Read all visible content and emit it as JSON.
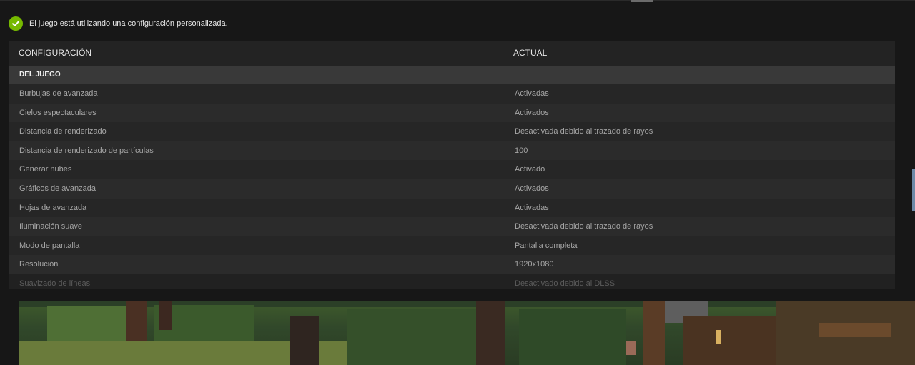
{
  "status": {
    "icon": "check-circle-icon",
    "message": "El juego está utilizando una configuración personalizada."
  },
  "table": {
    "headers": {
      "setting": "CONFIGURACIÓN",
      "current": "ACTUAL"
    },
    "section": "DEL JUEGO",
    "rows": [
      {
        "setting": "Burbujas de avanzada",
        "value": "Activadas"
      },
      {
        "setting": "Cielos espectaculares",
        "value": "Activados"
      },
      {
        "setting": "Distancia de renderizado",
        "value": "Desactivada debido al trazado de rayos"
      },
      {
        "setting": "Distancia de renderizado de partículas",
        "value": "100"
      },
      {
        "setting": "Generar nubes",
        "value": "Activado"
      },
      {
        "setting": "Gráficos de avanzada",
        "value": "Activados"
      },
      {
        "setting": "Hojas de avanzada",
        "value": "Activadas"
      },
      {
        "setting": "Iluminación suave",
        "value": "Desactivada debido al trazado de rayos"
      },
      {
        "setting": "Modo de pantalla",
        "value": "Pantalla completa"
      },
      {
        "setting": "Resolución",
        "value": "1920x1080"
      },
      {
        "setting": "Suavizado de líneas",
        "value": "Desactivado debido al DLSS"
      }
    ]
  },
  "colors": {
    "accent": "#76b900",
    "panel": "#1e1e1e",
    "section": "#393939"
  }
}
